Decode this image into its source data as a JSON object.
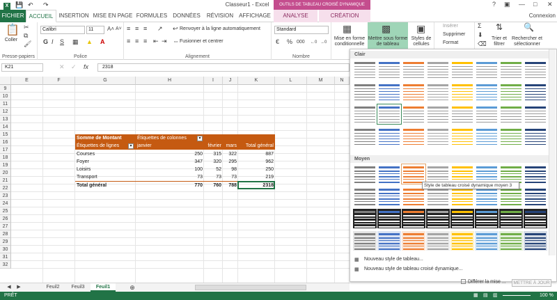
{
  "titlebar": {
    "title": "Classeur1 - Excel",
    "context_header": "OUTILS DE TABLEAU CROISÉ DYNAMIQUE",
    "help": "?",
    "connexion": "Connexion"
  },
  "tabs": [
    {
      "label": "FICHIER"
    },
    {
      "label": "ACCUEIL"
    },
    {
      "label": "INSERTION"
    },
    {
      "label": "MISE EN PAGE"
    },
    {
      "label": "FORMULES"
    },
    {
      "label": "DONNÉES"
    },
    {
      "label": "RÉVISION"
    },
    {
      "label": "AFFICHAGE"
    },
    {
      "label": "ANALYSE"
    },
    {
      "label": "CRÉATION"
    }
  ],
  "ribbon": {
    "clipboard": {
      "paste": "Coller",
      "label": "Presse-papiers"
    },
    "font": {
      "name": "Calibri",
      "size": "11",
      "label": "Police",
      "bold": "G",
      "italic": "I",
      "underline": "S"
    },
    "alignment": {
      "wrap": "Renvoyer à la ligne automatiquement",
      "merge": "Fusionner et centrer",
      "label": "Alignement"
    },
    "number": {
      "format": "Standard",
      "label": "Nombre",
      "percent": "%",
      "thousands": "000"
    },
    "styles": {
      "conditional": "Mise en forme conditionnelle",
      "format_table": "Mettre sous forme de tableau",
      "cell_styles": "Styles de cellules"
    },
    "cells": {
      "insert": "Insérer",
      "delete": "Supprimer",
      "format": "Format"
    },
    "editing": {
      "sort": "Trier et filtrer",
      "find": "Rechercher et sélectionner"
    }
  },
  "formula_bar": {
    "namebox": "K21",
    "formula": "2318",
    "fx": "fx"
  },
  "columns": [
    "E",
    "F",
    "G",
    "H",
    "I",
    "J",
    "K",
    "L",
    "M",
    "N"
  ],
  "rows": [
    "9",
    "10",
    "11",
    "12",
    "13",
    "14",
    "15",
    "16",
    "17",
    "18",
    "19",
    "20",
    "21",
    "22",
    "23",
    "24",
    "25",
    "26",
    "27",
    "28",
    "29",
    "30",
    "31",
    "32"
  ],
  "pivot": {
    "r15": [
      "Somme de Montant",
      "Étiquettes de colonnes"
    ],
    "r16": [
      "Étiquettes de lignes",
      "janvier",
      "février",
      "mars",
      "Total général"
    ],
    "body": [
      [
        "Courses",
        "250",
        "315",
        "322",
        "887"
      ],
      [
        "Foyer",
        "347",
        "320",
        "295",
        "962"
      ],
      [
        "Loisirs",
        "100",
        "52",
        "98",
        "250"
      ],
      [
        "Transport",
        "73",
        "73",
        "73",
        "219"
      ]
    ],
    "total": [
      "Total général",
      "770",
      "760",
      "788",
      "2318"
    ]
  },
  "sheets": [
    "Feuil2",
    "Feuil3",
    "Feuil1"
  ],
  "status": {
    "ready": "PRÊT",
    "zoom": "100 %"
  },
  "gallery": {
    "light": "Clair",
    "medium": "Moyen",
    "tooltip": "Style de tableau croisé dynamique moyen 3",
    "new_table": "Nouveau style de tableau...",
    "new_pivot": "Nouveau style de tableau croisé dynamique..."
  },
  "defer": "Différer la mise ...",
  "update": "METTRE À JOUR",
  "colors": {
    "excel_green": "#217346",
    "pivot_orange": "#c55a11",
    "context_pink": "#c44d8e"
  }
}
